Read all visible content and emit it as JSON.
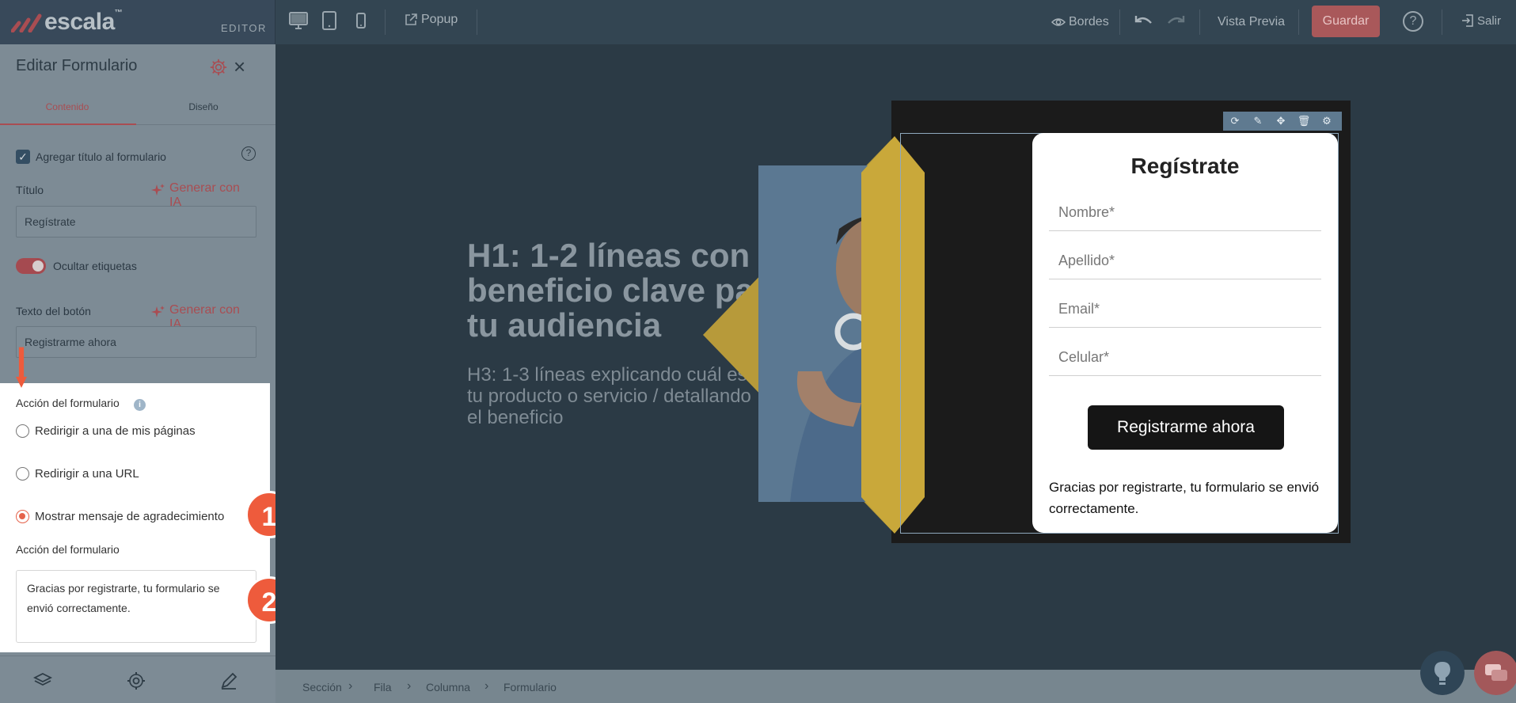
{
  "topbar": {
    "logo": "escala",
    "logo_mark": "™",
    "editor_label": "EDITOR",
    "popup_label": "Popup",
    "bordes_label": "Bordes",
    "preview_label": "Vista Previa",
    "save_label": "Guardar",
    "help_label": "?",
    "exit_label": "Salir"
  },
  "sidebar": {
    "title": "Editar Formulario",
    "close": "×",
    "tabs": [
      {
        "label": "Contenido",
        "active": true
      },
      {
        "label": "Diseño",
        "active": false
      }
    ],
    "add_title_label": "Agregar título al formulario",
    "add_title_checked": true,
    "title_field_label": "Título",
    "title_value": "Regístrate",
    "generate_ai_label": "Generar con IA",
    "hide_labels_label": "Ocultar etiquetas",
    "hide_labels_on": true,
    "button_text_label": "Texto del botón",
    "button_text_value": "Registrarme ahora",
    "action_label": "Acción del formulario",
    "action_options": [
      {
        "label": "Redirigir a una de mis páginas",
        "selected": false
      },
      {
        "label": "Redirigir a una URL",
        "selected": false
      },
      {
        "label": "Mostrar mensaje de agradecimiento",
        "selected": true
      }
    ],
    "action_message_label": "Acción del formulario",
    "action_message_value": "Gracias por registrarte, tu formulario se envió correctamente.",
    "badges": [
      "1",
      "2"
    ]
  },
  "canvas": {
    "h1": "H1: 1-2 líneas con un beneficio clave para tu audiencia",
    "h3": "H3: 1-3 líneas explicando cuál es tu producto o servicio / detallando el beneficio",
    "form": {
      "title": "Regístrate",
      "fields": [
        "Nombre*",
        "Apellido*",
        "Email*",
        "Celular*"
      ],
      "button": "Registrarme ahora",
      "thanks": "Gracias por registrarte, tu formulario se envió correctamente."
    }
  },
  "breadcrumb": [
    "Sección",
    "Fila",
    "Columna",
    "Formulario"
  ],
  "colors": {
    "accent_red": "#a94d52",
    "badge_orange": "#ee5b3c",
    "diamond_yellow": "#f5c518"
  },
  "icons": [
    "desktop-icon",
    "tablet-icon",
    "mobile-icon",
    "external-link-icon",
    "eye-icon",
    "undo-icon",
    "redo-icon",
    "exit-icon",
    "gear-icon",
    "close-icon",
    "help-icon",
    "sparkle-icon",
    "info-icon",
    "layers-icon",
    "settings-icon",
    "pen-icon",
    "refresh-icon",
    "edit-icon",
    "move-icon",
    "trash-icon",
    "lightbulb-icon",
    "chat-icon"
  ]
}
